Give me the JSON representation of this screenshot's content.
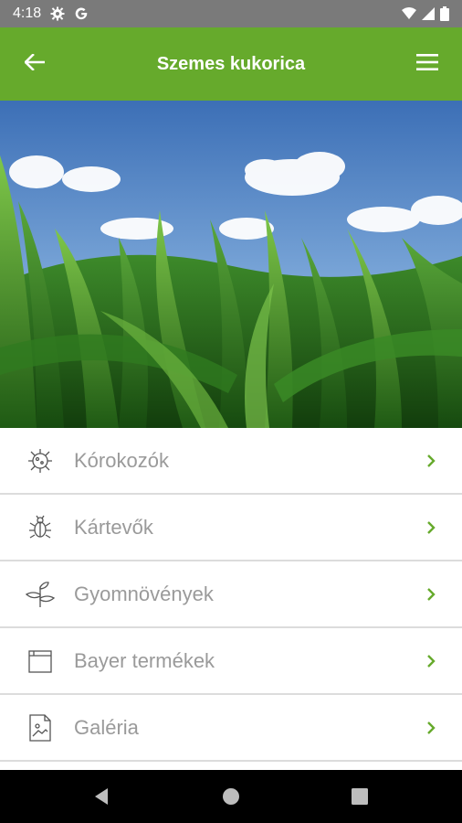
{
  "status_bar": {
    "time": "4:18",
    "icons": [
      "settings-icon",
      "google-icon",
      "wifi-icon",
      "signal-icon",
      "battery-icon"
    ],
    "background": "#7a7a7a"
  },
  "app_bar": {
    "title": "Szemes kukorica",
    "background": "#66aa2c",
    "back_icon": "arrow-left-icon",
    "menu_icon": "hamburger-menu-icon"
  },
  "hero": {
    "subject": "corn field under blue sky"
  },
  "menu": {
    "items": [
      {
        "label": "Kórokozók",
        "icon": "pathogen-icon"
      },
      {
        "label": "Kártevők",
        "icon": "bug-icon"
      },
      {
        "label": "Gyomnövények",
        "icon": "plant-sprout-icon"
      },
      {
        "label": "Bayer termékek",
        "icon": "product-box-icon"
      },
      {
        "label": "Galéria",
        "icon": "gallery-image-icon"
      }
    ],
    "chevron_color": "#66aa2c"
  },
  "nav_bar": {
    "buttons": [
      "back-triangle-icon",
      "home-circle-icon",
      "recents-square-icon"
    ]
  }
}
